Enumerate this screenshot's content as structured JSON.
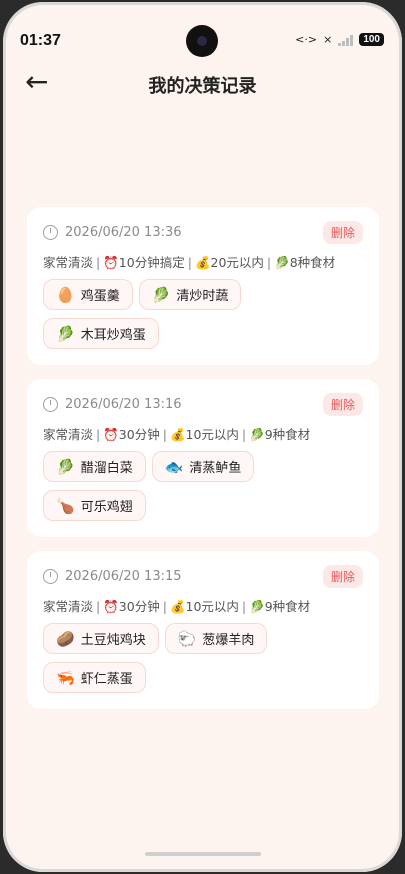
{
  "status": {
    "time": "01:37",
    "battery": "100",
    "net_icon": "<·>",
    "x_mark": "×"
  },
  "header": {
    "back_icon": "←",
    "title": "我的决策记录"
  },
  "records": [
    {
      "datetime": "2026/06/20 13:36",
      "delete_label": "删除",
      "style": "家常清淡",
      "time": "⏰10分钟搞定",
      "budget": "💰20元以内",
      "ingredients": "🥬8种食材",
      "dishes": [
        {
          "emoji": "🥚",
          "name": "鸡蛋羹"
        },
        {
          "emoji": "🥬",
          "name": "清炒时蔬"
        },
        {
          "emoji": "🥬",
          "name": "木耳炒鸡蛋"
        }
      ]
    },
    {
      "datetime": "2026/06/20 13:16",
      "delete_label": "删除",
      "style": "家常清淡",
      "time": "⏰30分钟",
      "budget": "💰10元以内",
      "ingredients": "🥬9种食材",
      "dishes": [
        {
          "emoji": "🥬",
          "name": "醋溜白菜"
        },
        {
          "emoji": "🐟",
          "name": "清蒸鲈鱼"
        },
        {
          "emoji": "🍗",
          "name": "可乐鸡翅"
        }
      ]
    },
    {
      "datetime": "2026/06/20 13:15",
      "delete_label": "删除",
      "style": "家常清淡",
      "time": "⏰30分钟",
      "budget": "💰10元以内",
      "ingredients": "🥬9种食材",
      "dishes": [
        {
          "emoji": "🥔",
          "name": "土豆炖鸡块"
        },
        {
          "emoji": "🐑",
          "name": "葱爆羊肉"
        },
        {
          "emoji": "🦐",
          "name": "虾仁蒸蛋"
        }
      ]
    }
  ],
  "separator": "|"
}
